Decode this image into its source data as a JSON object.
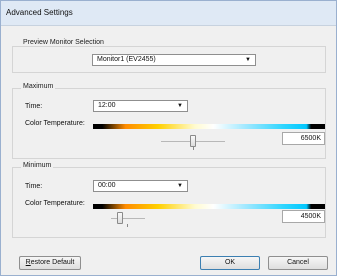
{
  "window": {
    "title": "Advanced Settings"
  },
  "preview": {
    "group_label": "Preview Monitor Selection",
    "monitor_value": "Monitor1 (EV2455)"
  },
  "maximum": {
    "group_label": "Maximum",
    "time_label": "Time:",
    "time_value": "12:00",
    "color_temp_label": "Color Temperature:",
    "color_temp_value": "6500K",
    "slider_fraction": 0.5
  },
  "minimum": {
    "group_label": "Minimum",
    "time_label": "Time:",
    "time_value": "00:00",
    "color_temp_label": "Color Temperature:",
    "color_temp_value": "4500K",
    "slider_fraction": 0.25
  },
  "buttons": {
    "restore_default_underline": "R",
    "restore_default_rest": "estore Default",
    "ok": "OK",
    "cancel": "Cancel"
  },
  "icons": {
    "dropdown": "chevron-down-icon"
  }
}
